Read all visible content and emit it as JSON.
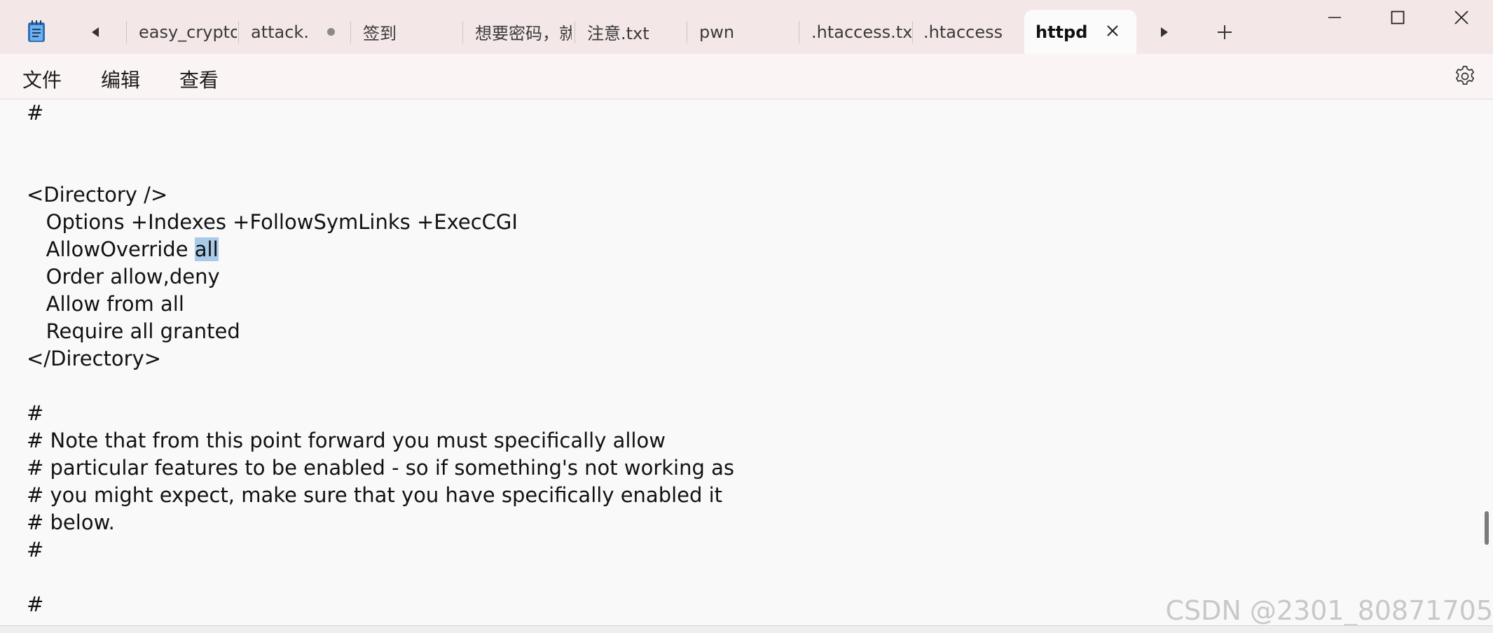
{
  "tabs": [
    {
      "label": "easy_crypto."
    },
    {
      "label": "attack.",
      "modified": true
    },
    {
      "label": "签到"
    },
    {
      "label": "想要密码，就"
    },
    {
      "label": "注意.txt"
    },
    {
      "label": "pwn"
    },
    {
      "label": ".htaccess.txt"
    },
    {
      "label": ".htaccess"
    },
    {
      "label": "httpd",
      "active": true
    }
  ],
  "menu": {
    "file": "文件",
    "edit": "编辑",
    "view": "查看"
  },
  "editor": {
    "lines": [
      "#",
      "",
      "",
      "<Directory />",
      "   Options +Indexes +FollowSymLinks +ExecCGI",
      "   AllowOverride ",
      "   Order allow,deny",
      "   Allow from all",
      "   Require all granted",
      "</Directory>",
      "",
      "#",
      "# Note that from this point forward you must specifically allow",
      "# particular features to be enabled - so if something's not working as",
      "# you might expect, make sure that you have specifically enabled it",
      "# below.",
      "#",
      "",
      "#"
    ],
    "selected_text": "all"
  },
  "watermark": "CSDN @2301_80871705",
  "colors": {
    "titlebar": "#f4e7e8",
    "menubar": "#fbf4f4",
    "editor": "#f9f9f9",
    "selection": "#a9cbe9"
  },
  "icons": {
    "app": "notepad-icon",
    "settings": "gear-icon",
    "close": "close-icon"
  }
}
